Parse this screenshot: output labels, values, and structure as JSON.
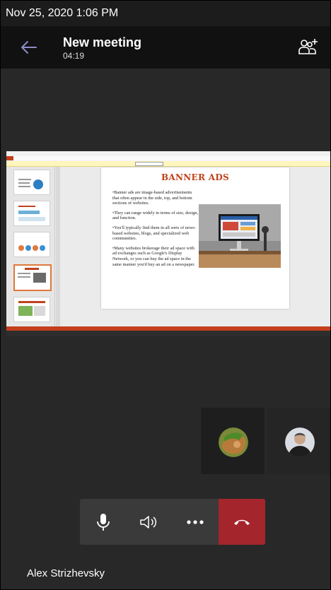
{
  "status_bar": {
    "datetime": "Nov 25, 2020  1:06 PM"
  },
  "header": {
    "title": "New meeting",
    "elapsed": "04:19",
    "back_icon": "arrow-left-icon",
    "participants_icon": "add-people-icon"
  },
  "shared_content": {
    "slide_title": "BANNER ADS",
    "bullets": [
      "•Banner ads  are image-based advertisements that often appear in the side, top, and bottom sections of websites.",
      "•They can range widely in terms of size, design, and function.",
      "•You'll typically find them in all sorts of news-based websites, blogs, and specialized web communities.",
      "•Many websites brokerage their ad space with ad exchanges such as Google's Display Network, or you can buy the ad space in the same manner you'd buy an ad on a newspaper."
    ]
  },
  "controls": {
    "mic_icon": "microphone-icon",
    "speaker_icon": "speaker-icon",
    "more_icon": "more-options-icon",
    "hangup_icon": "hang-up-icon",
    "hangup_color": "#a4262c"
  },
  "footer": {
    "user_name": "Alex Strizhevsky"
  },
  "colors": {
    "accent": "#8b8cc7",
    "background": "#282828"
  }
}
